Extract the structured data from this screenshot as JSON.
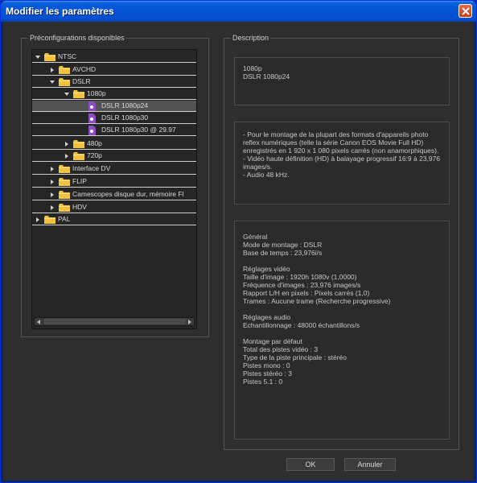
{
  "window": {
    "title": "Modifier les paramètres"
  },
  "presets": {
    "group_title": "Préconfigurations disponibles",
    "tree": [
      {
        "label": "NTSC",
        "kind": "folder",
        "expanded": true
      },
      {
        "label": "AVCHD",
        "kind": "folder",
        "expanded": false
      },
      {
        "label": "DSLR",
        "kind": "folder",
        "expanded": true
      },
      {
        "label": "1080p",
        "kind": "folder",
        "expanded": true
      },
      {
        "label": "DSLR 1080p24",
        "kind": "preset",
        "selected": true
      },
      {
        "label": "DSLR 1080p30",
        "kind": "preset"
      },
      {
        "label": "DSLR 1080p30 @ 29.97",
        "kind": "preset"
      },
      {
        "label": "480p",
        "kind": "folder",
        "expanded": false
      },
      {
        "label": "720p",
        "kind": "folder",
        "expanded": false
      },
      {
        "label": "Interface DV",
        "kind": "folder",
        "expanded": false
      },
      {
        "label": "FLIP",
        "kind": "folder",
        "expanded": false
      },
      {
        "label": "Camescopes disque dur, mémoire Fl",
        "kind": "folder",
        "expanded": false
      },
      {
        "label": "HDV",
        "kind": "folder",
        "expanded": false
      },
      {
        "label": "PAL",
        "kind": "folder",
        "expanded": false
      }
    ]
  },
  "description": {
    "group_title": "Description",
    "summary": "1080p\nDSLR 1080p24",
    "details": "- Pour le montage de la plupart des formats d'appareils photo reflex numériques (telle la série Canon EOS Movie Full HD) enregistrés en 1 920 x 1 080 pixels carrés (non anamorphiques).\n- Vidéo haute définition (HD) à balayage progressif 16:9 à 23,976 images/s.\n- Audio 48 kHz.",
    "general_heading": "Général",
    "general_lines": "Mode de montage : DSLR\nBase de temps : 23,976i/s",
    "video_heading": "Réglages vidéo",
    "video_lines": "Taille d'image : 1920h 1080v (1,0000)\nFréquence d'images : 23,976 images/s\nRapport L/H en pixels : Pixels carrés (1,0)\nTrames : Aucune trame (Recherche progressive)",
    "audio_heading": "Réglages audio",
    "audio_lines": "Echantillonnage : 48000 échantillons/s",
    "tracks_heading": "Montage par défaut",
    "tracks_lines": "Total des pistes vidéo : 3\nType de la piste principale : stéréo\nPistes mono : 0\nPistes stéréo : 3\nPistes 5.1 : 0"
  },
  "buttons": {
    "ok": "OK",
    "cancel": "Annuler"
  },
  "colors": {
    "title_bar": "#0453d6",
    "panel_bg": "#2e2e2e",
    "folder": "#f2c23c",
    "preset_icon": "#8a4fc0",
    "close_button": "#d4481e"
  },
  "icons": {
    "folder": "folder-icon",
    "preset": "preset-file-icon",
    "close": "close-icon"
  }
}
